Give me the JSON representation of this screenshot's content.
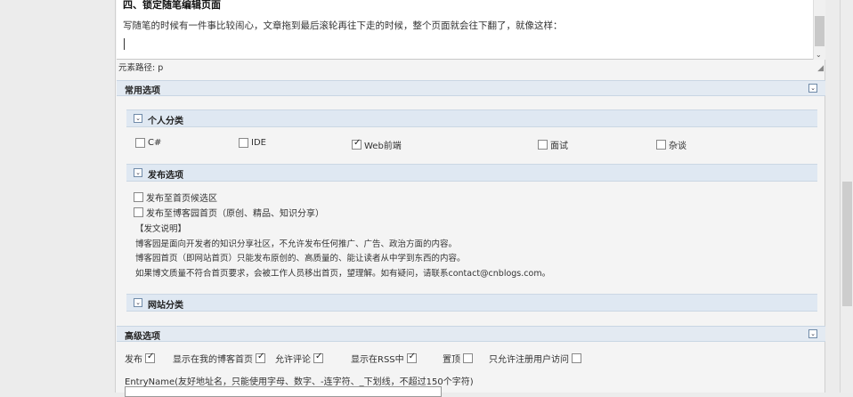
{
  "editor": {
    "heading": "四、锁定随笔编辑页面",
    "paragraph": "写随笔的时候有一件事比较闹心，文章拖到最后滚轮再往下走的时候，整个页面就会往下翻了，就像这样：",
    "scroll_arrow": "⌄",
    "element_path": "元素路径: p"
  },
  "common": {
    "title": "常用选项",
    "toggle": "⌄",
    "personal": {
      "title": "个人分类",
      "toggle": "⌄",
      "items": [
        {
          "label": "C#",
          "checked": false
        },
        {
          "label": "IDE",
          "checked": false
        },
        {
          "label": "Web前端",
          "checked": true
        },
        {
          "label": "面试",
          "checked": false
        },
        {
          "label": "杂谈",
          "checked": false
        }
      ]
    },
    "publish": {
      "title": "发布选项",
      "toggle": "⌄",
      "options": [
        {
          "label": "发布至首页候选区",
          "checked": false
        },
        {
          "label": "发布至博客园首页（原创、精品、知识分享）",
          "checked": false
        }
      ],
      "notes": [
        "【发文说明】",
        "博客园是面向开发者的知识分享社区，不允许发布任何推广、广告、政治方面的内容。",
        "博客园首页（即网站首页）只能发布原创的、高质量的、能让读者从中学到东西的内容。",
        "如果博文质量不符合首页要求，会被工作人员移出首页，望理解。如有疑问，请联系contact@cnblogs.com。"
      ]
    },
    "site": {
      "title": "网站分类",
      "toggle": "⌄"
    }
  },
  "advanced": {
    "title": "高级选项",
    "toggle": "⌄",
    "options": [
      {
        "label": "发布",
        "checked": true
      },
      {
        "label": "显示在我的博客首页",
        "checked": true
      },
      {
        "label": "允许评论",
        "checked": true
      },
      {
        "label": "显示在RSS中",
        "checked": true
      },
      {
        "label": "置顶",
        "checked": false
      },
      {
        "label": "只允许注册用户访问",
        "checked": false
      }
    ],
    "entry_label": "EntryName(友好地址名，只能使用字母、数字、-连字符、_下划线，不超过150个字符)",
    "entry_value": ""
  }
}
